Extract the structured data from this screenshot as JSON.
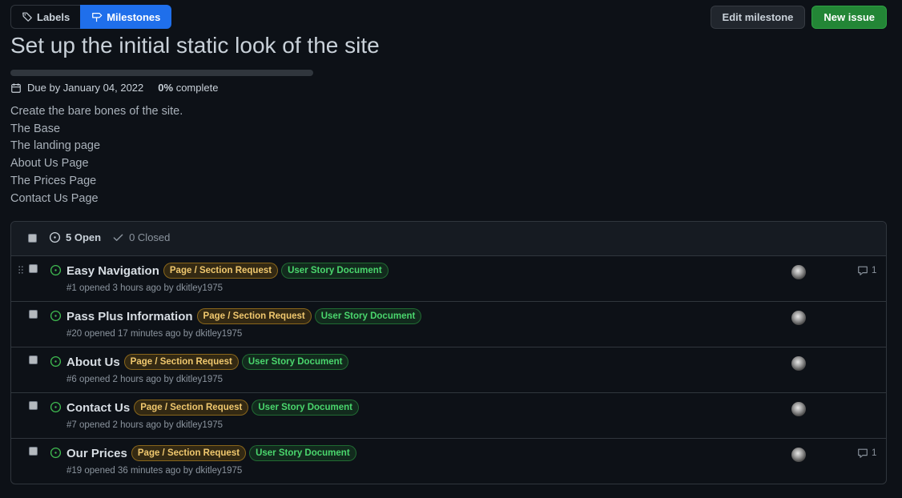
{
  "nav": {
    "labels_label": "Labels",
    "milestones_label": "Milestones"
  },
  "toolbar": {
    "edit_label": "Edit milestone",
    "new_issue_label": "New issue"
  },
  "milestone": {
    "title": "Set up the initial static look of the site",
    "progress_fraction": 0,
    "due_text": "Due by January 04, 2022",
    "percent_value": "0%",
    "percent_suffix": " complete",
    "description": [
      "Create the bare bones of the site.",
      "The Base",
      "The landing page",
      "About Us Page",
      "The Prices Page",
      "Contact Us Page"
    ]
  },
  "issues_header": {
    "open_label": "5 Open",
    "closed_label": "0 Closed"
  },
  "issues": [
    {
      "title": "Easy Navigation",
      "labels": [
        "Page / Section Request",
        "User Story Document"
      ],
      "meta": "#1 opened 3 hours ago by dkitley1975",
      "comments": "1"
    },
    {
      "title": "Pass Plus Information",
      "labels": [
        "Page / Section Request",
        "User Story Document"
      ],
      "meta": "#20 opened 17 minutes ago by dkitley1975",
      "comments": ""
    },
    {
      "title": "About Us",
      "labels": [
        "Page / Section Request",
        "User Story Document"
      ],
      "meta": "#6 opened 2 hours ago by dkitley1975",
      "comments": ""
    },
    {
      "title": "Contact Us",
      "labels": [
        "Page / Section Request",
        "User Story Document"
      ],
      "meta": "#7 opened 2 hours ago by dkitley1975",
      "comments": ""
    },
    {
      "title": "Our Prices",
      "labels": [
        "Page / Section Request",
        "User Story Document"
      ],
      "meta": "#19 opened 36 minutes ago by dkitley1975",
      "comments": "1"
    }
  ],
  "colors": {
    "background": "#0d1117",
    "accent_blue": "#1f6feb",
    "primary_green": "#238636",
    "open_icon_green": "#3fb950",
    "label_page": "#f0c86e",
    "label_story": "#4ad66d"
  }
}
